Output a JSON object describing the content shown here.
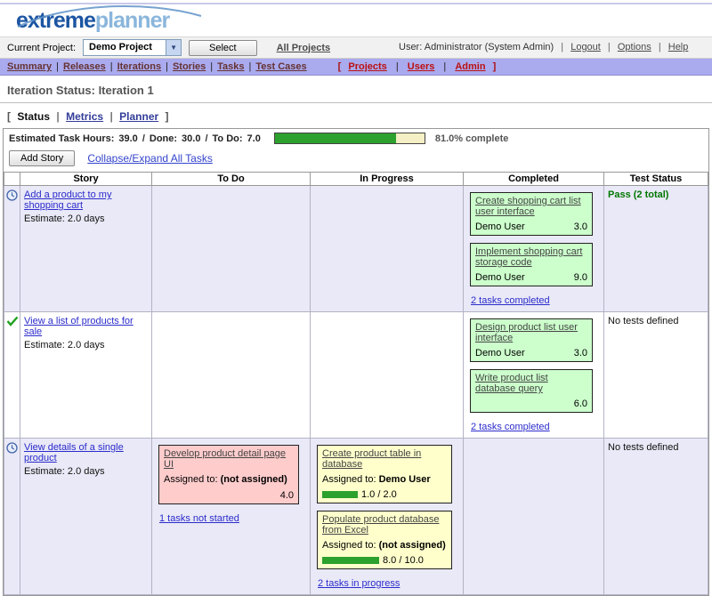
{
  "brand": {
    "logo_extreme": "extreme",
    "logo_planner": "planner"
  },
  "project_bar": {
    "label": "Current Project:",
    "selected_project": "Demo Project",
    "select_button": "Select",
    "all_projects_link": "All Projects",
    "user_text": "User: Administrator (System Admin)",
    "logout_link": "Logout",
    "options_link": "Options",
    "help_link": "Help",
    "separator": "|"
  },
  "nav": {
    "items": [
      "Summary",
      "Releases",
      "Iterations",
      "Stories",
      "Tasks",
      "Test Cases"
    ],
    "admin_items": [
      "Projects",
      "Users",
      "Admin"
    ],
    "separator": "|",
    "bracket_open": "[",
    "bracket_close": "]"
  },
  "page": {
    "title": "Iteration Status: Iteration 1"
  },
  "tabs": {
    "bracket_open": "[",
    "bracket_close": "]",
    "active": "Status",
    "metrics": "Metrics",
    "planner": "Planner",
    "separator": "|"
  },
  "stats": {
    "label": "Estimated Task Hours:",
    "estimated": "39.0",
    "slash": "/",
    "done_label": "Done:",
    "done": "30.0",
    "todo_label": "To Do:",
    "todo": "7.0",
    "percent": 81,
    "percent_label": "81.0% complete"
  },
  "toolbar": {
    "add_story": "Add Story",
    "collapse_link": "Collapse/Expand All Tasks"
  },
  "table": {
    "headers": [
      "Story",
      "To Do",
      "In Progress",
      "Completed",
      "Test Status"
    ]
  },
  "stories": [
    {
      "icon": "clock-icon",
      "title": "Add a product to my shopping cart",
      "estimate": "Estimate: 2.0 days",
      "completed_tasks": [
        {
          "title": "Create shopping cart list user interface",
          "user": "Demo User",
          "hours": "3.0"
        },
        {
          "title": "Implement shopping cart storage code",
          "user": "Demo User",
          "hours": "9.0"
        }
      ],
      "completed_link": "2 tasks completed",
      "test_status": "Pass (2 total)"
    },
    {
      "icon": "check-icon",
      "title": "View a list of products for sale",
      "estimate": "Estimate: 2.0 days",
      "completed_tasks": [
        {
          "title": "Design product list user interface",
          "user": "Demo User",
          "hours": "3.0"
        },
        {
          "title": "Write product list database query",
          "user": "",
          "hours": "6.0"
        }
      ],
      "completed_link": "2 tasks completed",
      "test_status": "No tests defined"
    },
    {
      "icon": "clock-icon",
      "title": "View details of a single product",
      "estimate": "Estimate: 2.0 days",
      "todo_tasks": [
        {
          "title": "Develop product detail page UI",
          "assigned_label": "Assigned to:",
          "assignee": "(not assigned)",
          "hours": "4.0"
        }
      ],
      "todo_link": "1 tasks not started",
      "inprogress_tasks": [
        {
          "title": "Create product table in database",
          "assigned_label": "Assigned to:",
          "assignee": "Demo User",
          "progress_text": "1.0 / 2.0",
          "progress_pct": 50
        },
        {
          "title": "Populate product database from Excel",
          "assigned_label": "Assigned to:",
          "assignee": "(not assigned)",
          "progress_text": "8.0 / 10.0",
          "progress_pct": 80
        }
      ],
      "inprogress_link": "2 tasks in progress",
      "test_status": "No tests defined"
    }
  ],
  "colors": {
    "nav_bg": "#aaaaee",
    "progress_green": "#2da12d",
    "card_completed_bg": "#ccffcc",
    "card_todo_bg": "#ffcccc",
    "card_inprogress_bg": "#ffffcc",
    "row_alt_bg": "#e9e9f7",
    "pass_green": "#007700"
  }
}
